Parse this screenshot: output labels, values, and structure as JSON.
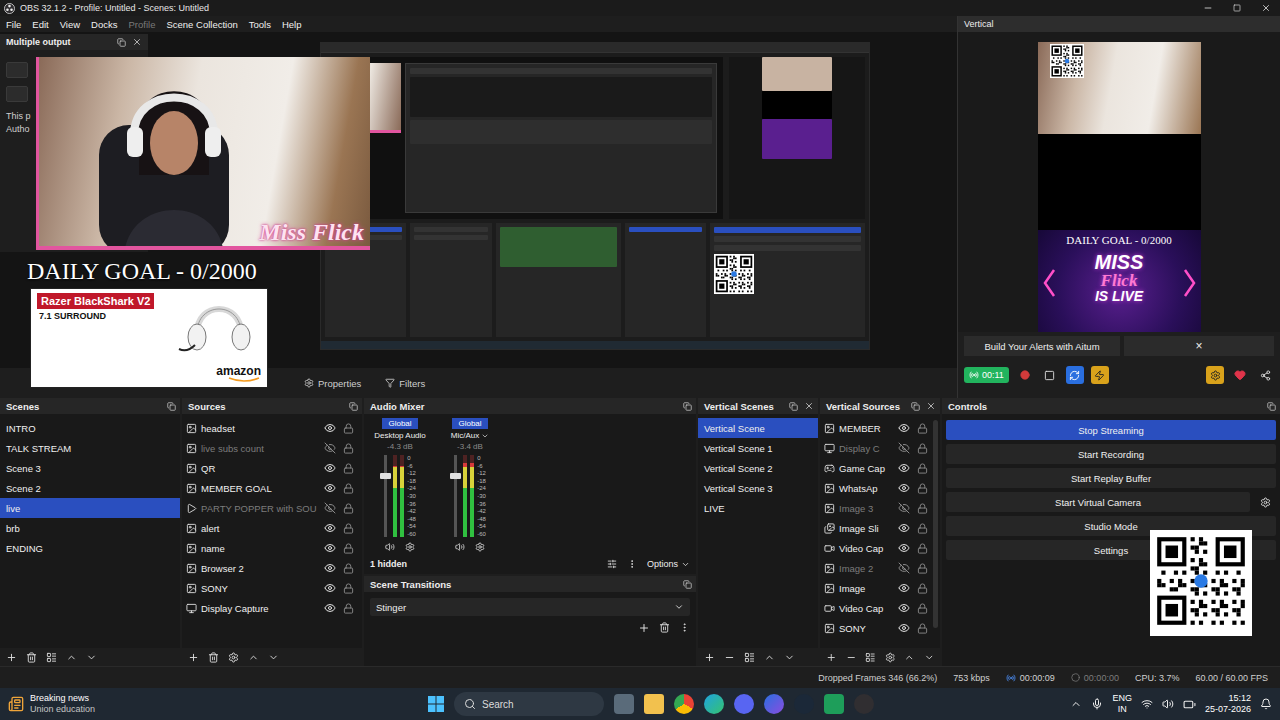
{
  "window": {
    "title": "OBS 32.1.2 - Profile: Untitled - Scenes: Untitled"
  },
  "menu": [
    {
      "label": "File",
      "disabled": false
    },
    {
      "label": "Edit",
      "disabled": false
    },
    {
      "label": "View",
      "disabled": false
    },
    {
      "label": "Docks",
      "disabled": false
    },
    {
      "label": "Profile",
      "disabled": true
    },
    {
      "label": "Scene Collection",
      "disabled": false
    },
    {
      "label": "Tools",
      "disabled": false
    },
    {
      "label": "Help",
      "disabled": false
    }
  ],
  "multiple_output": {
    "title": "Multiple output",
    "lines": [
      "This p",
      "Autho"
    ]
  },
  "preview": {
    "caption": "Miss Flick",
    "goal": "DAILY GOAL - 0/2000",
    "ad": {
      "title": "Razer BlackShark V2",
      "subtitle": "7.1 SURROUND",
      "brand": "amazon"
    }
  },
  "preview_bar": {
    "buttons": [
      {
        "label": "Properties",
        "kind": "properties"
      },
      {
        "label": "Filters",
        "kind": "filters"
      }
    ]
  },
  "vertical": {
    "title": "Vertical",
    "goal": "DAILY GOAL - 0/2000",
    "live_banner": [
      "MISS",
      "Flick",
      "IS LIVE"
    ],
    "banner": "Build Your Alerts with Aitum",
    "close": "×",
    "timer": "00:11",
    "streaming": true
  },
  "scenes": {
    "title": "Scenes",
    "items": [
      {
        "name": "INTRO",
        "selected": false
      },
      {
        "name": "TALK STREAM",
        "selected": false
      },
      {
        "name": "Scene 3",
        "selected": false
      },
      {
        "name": "Scene 2",
        "selected": false
      },
      {
        "name": "live",
        "selected": true
      },
      {
        "name": "brb",
        "selected": false
      },
      {
        "name": "ENDING",
        "selected": false
      }
    ]
  },
  "sources": {
    "title": "Sources",
    "items": [
      {
        "name": "headset",
        "kind": "image",
        "visible": true,
        "locked": false
      },
      {
        "name": "live subs count",
        "kind": "image",
        "visible": false,
        "locked": false
      },
      {
        "name": "QR",
        "kind": "image",
        "visible": true,
        "locked": false
      },
      {
        "name": "MEMBER GOAL",
        "kind": "image",
        "visible": true,
        "locked": false
      },
      {
        "name": "PARTY POPPER with SOU",
        "kind": "media",
        "visible": false,
        "locked": false
      },
      {
        "name": "alert",
        "kind": "image",
        "visible": true,
        "locked": false
      },
      {
        "name": "name",
        "kind": "image",
        "visible": true,
        "locked": false
      },
      {
        "name": "Browser 2",
        "kind": "image",
        "visible": true,
        "locked": false
      },
      {
        "name": "SONY",
        "kind": "image",
        "visible": true,
        "locked": false
      },
      {
        "name": "Display Capture",
        "kind": "display",
        "visible": true,
        "locked": false
      }
    ]
  },
  "audio_mixer": {
    "title": "Audio Mixer",
    "channels": [
      {
        "name": "Desktop Audio",
        "tag": "Global",
        "reading": "-4.3 dB",
        "level": 0.86,
        "volume": 0.78,
        "muted": false,
        "dropdown": false
      },
      {
        "name": "Mic/Aux",
        "tag": "Global",
        "reading": "-3.4 dB",
        "level": 0.9,
        "volume": 0.78,
        "muted": false,
        "dropdown": true
      }
    ],
    "scale": [
      "0",
      "-6",
      "-12",
      "-18",
      "-24",
      "-30",
      "-36",
      "-42",
      "-48",
      "-54",
      "-60"
    ],
    "hidden": "1 hidden",
    "options": "Options"
  },
  "scene_transitions": {
    "title": "Scene Transitions",
    "selected": "Stinger"
  },
  "vertical_scenes": {
    "title": "Vertical Scenes",
    "items": [
      {
        "name": "Vertical Scene",
        "selected": true
      },
      {
        "name": "Vertical Scene 1",
        "selected": false
      },
      {
        "name": "Vertical Scene 2",
        "selected": false
      },
      {
        "name": "Vertical Scene 3",
        "selected": false
      },
      {
        "name": "LIVE",
        "selected": false
      }
    ]
  },
  "vertical_sources": {
    "title": "Vertical Sources",
    "items": [
      {
        "name": "MEMBER",
        "kind": "image",
        "visible": true,
        "locked": false
      },
      {
        "name": "Display C",
        "kind": "display",
        "visible": false,
        "locked": false
      },
      {
        "name": "Game Cap",
        "kind": "game",
        "visible": true,
        "locked": false
      },
      {
        "name": "WhatsAp",
        "kind": "image",
        "visible": true,
        "locked": false
      },
      {
        "name": "Image 3",
        "kind": "image",
        "visible": false,
        "locked": false
      },
      {
        "name": "Image Sli",
        "kind": "slideshow",
        "visible": true,
        "locked": false
      },
      {
        "name": "Video Cap",
        "kind": "video",
        "visible": true,
        "locked": false
      },
      {
        "name": "Image 2",
        "kind": "image",
        "visible": false,
        "locked": false
      },
      {
        "name": "Image",
        "kind": "image",
        "visible": true,
        "locked": false
      },
      {
        "name": "Video Cap",
        "kind": "video",
        "visible": true,
        "locked": false
      },
      {
        "name": "SONY",
        "kind": "image",
        "visible": true,
        "locked": false
      }
    ]
  },
  "controls": {
    "title": "Controls",
    "buttons": [
      {
        "label": "Stop Streaming",
        "selected": true,
        "kind": "plain"
      },
      {
        "label": "Start Recording",
        "selected": false,
        "kind": "plain"
      },
      {
        "label": "Start Replay Buffer",
        "selected": false,
        "kind": "plain"
      },
      {
        "label": "Start Virtual Camera",
        "selected": false,
        "kind": "with-settings"
      },
      {
        "label": "Studio Mode",
        "selected": false,
        "kind": "plain"
      },
      {
        "label": "Settings",
        "selected": false,
        "kind": "plain"
      }
    ]
  },
  "status_bar": {
    "dropped": "Dropped Frames 346 (66.2%)",
    "bitrate": "753 kbps",
    "stream_time": "00:00:09",
    "record_time": "00:00:00",
    "recording": false,
    "cpu": "CPU: 3.7%",
    "fps": "60.00 / 60.00 FPS"
  },
  "taskbar": {
    "news_title": "Breaking news",
    "news_text": "Union education",
    "search": "Search",
    "lang": "ENG",
    "region": "IN",
    "time": "15:12",
    "date": "25-07-2026"
  }
}
